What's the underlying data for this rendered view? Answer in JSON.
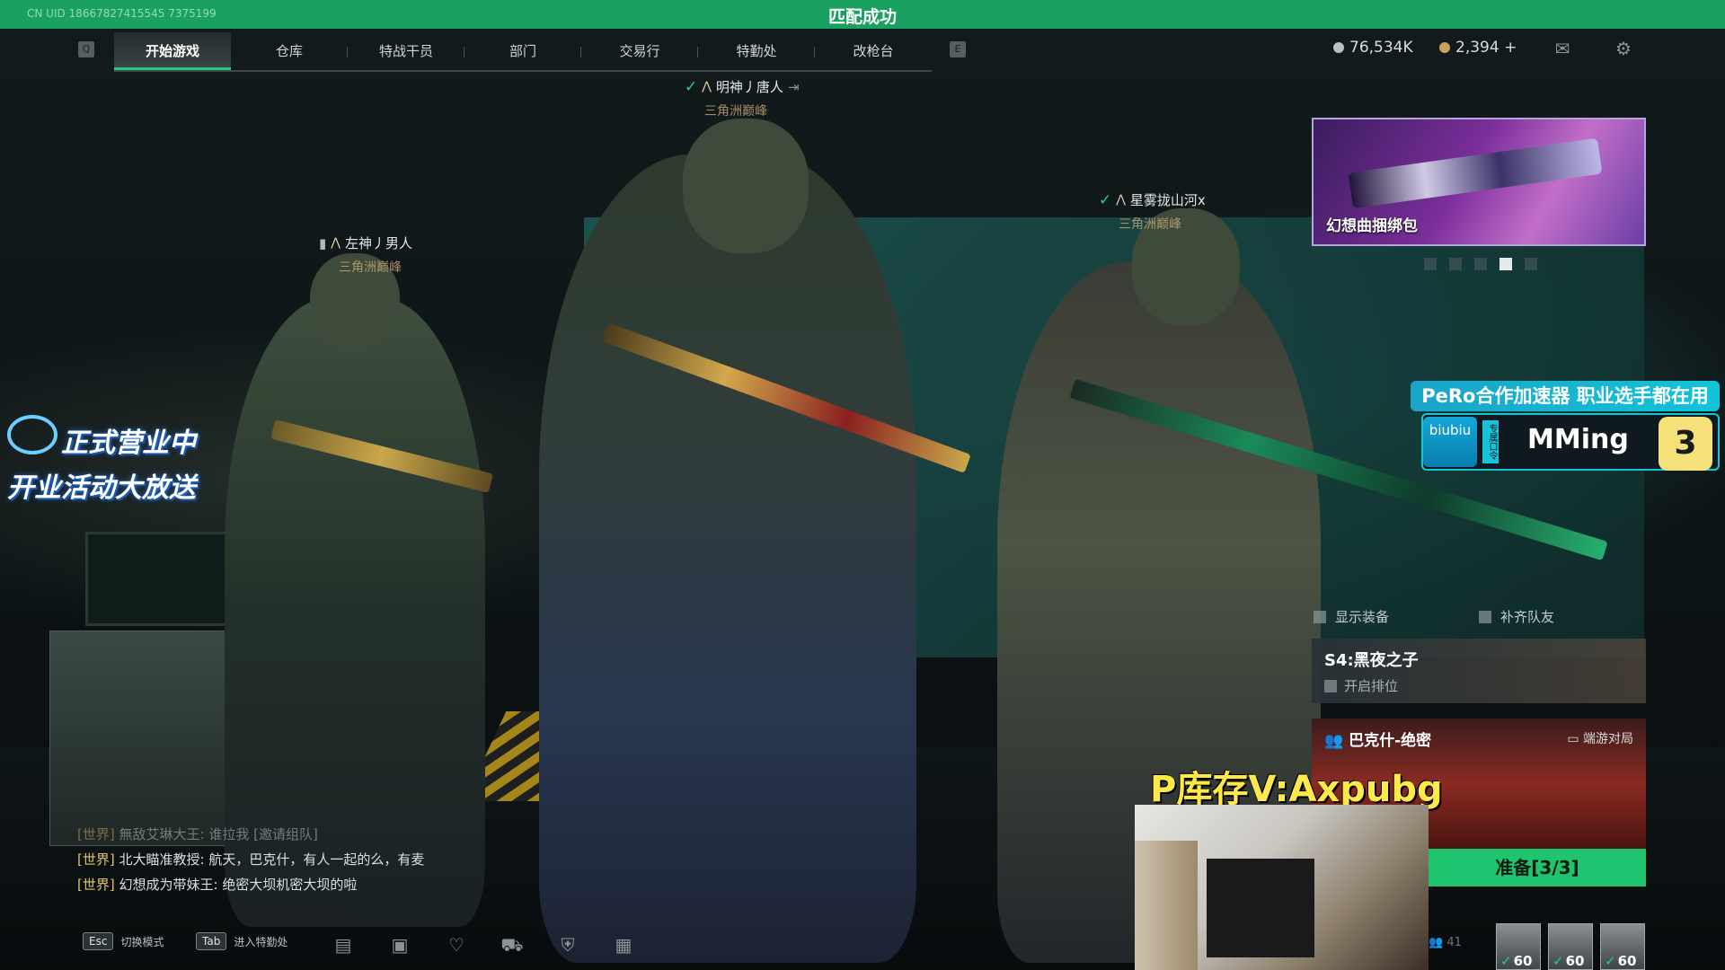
{
  "match_bar": {
    "uid": "CN UID 18667827415545 7375199",
    "title": "匹配成功"
  },
  "nav": {
    "left_key": "Q",
    "right_key": "E",
    "tabs": [
      "开始游戏",
      "仓库",
      "特战干员",
      "部门",
      "交易行",
      "特勤处",
      "改枪台"
    ],
    "active_tab": 0
  },
  "currency": {
    "hafcoin": "76,534K",
    "premium": "2,394 +"
  },
  "colors": {
    "accent": "#1fd07a",
    "match_bar": "#1aa060",
    "ready": "#1ec46e"
  },
  "players": [
    {
      "name": "明神丿唐人",
      "rank": "三角洲巅峰",
      "ready": true
    },
    {
      "name": "左神丿男人",
      "rank": "三角洲巅峰",
      "ready": false
    },
    {
      "name": "星雾拢山河x",
      "rank": "三角洲巅峰",
      "ready": true
    }
  ],
  "promo": {
    "label": "幻想曲捆绑包"
  },
  "options": {
    "show_gear": "显示装备",
    "fill_team": "补齐队友"
  },
  "season": {
    "title": "S4:黑夜之子",
    "ranked": "开启排位"
  },
  "mode": {
    "title": "巴克什-绝密",
    "type": "端游对局"
  },
  "ready_button": "准备[3/3]",
  "stream": {
    "sponsor_headline": "PeRo合作加速器 职业选手都在用",
    "sponsor_logo": "biubiu",
    "sponsor_tag": "专属口令",
    "streamer": "MMing",
    "badge": "3",
    "open_line1": "正式营业中",
    "open_line2": "开业活动大放送",
    "ad": "P库存V:Axpubg"
  },
  "chat": [
    {
      "channel": "[世界]",
      "text": "無敌艾琳大王: 谁拉我 [邀请组队]"
    },
    {
      "channel": "[世界]",
      "text": "北大瞄准教授: 航天，巴克什，有人一起的么，有麦"
    },
    {
      "channel": "[世界]",
      "text": "幻想成为带妹王: 绝密大坝机密大坝的啦"
    }
  ],
  "hotkeys": [
    {
      "key": "Esc",
      "label": "切换模式"
    },
    {
      "key": "Tab",
      "label": "进入特勤处"
    }
  ],
  "team": {
    "online": "41",
    "levels": [
      "60",
      "60",
      "60"
    ]
  }
}
